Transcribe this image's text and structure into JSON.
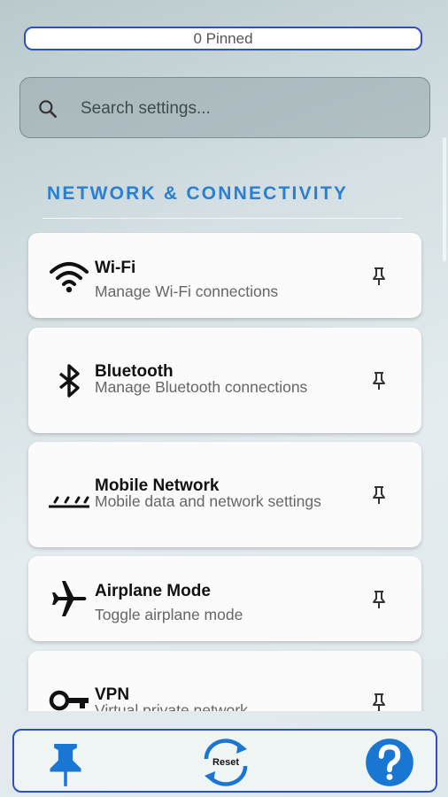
{
  "pinned_count_label": "0 Pinned",
  "search": {
    "placeholder": "Search settings..."
  },
  "section": {
    "title": "NETWORK & CONNECTIVITY"
  },
  "items": [
    {
      "title": "Wi-Fi",
      "description": "Manage Wi-Fi connections",
      "icon": "wifi-icon"
    },
    {
      "title": "Bluetooth",
      "description": "Manage Bluetooth connections",
      "icon": "bluetooth-icon"
    },
    {
      "title": "Mobile Network",
      "description": "Mobile data and network settings",
      "icon": "mobile-network-icon"
    },
    {
      "title": "Airplane Mode",
      "description": "Toggle airplane mode",
      "icon": "airplane-icon"
    },
    {
      "title": "VPN",
      "description": "Virtual private network",
      "icon": "key-icon"
    }
  ],
  "bottom_bar": {
    "reset_label": "Reset"
  },
  "colors": {
    "accent": "#2a7fd3",
    "border": "#2d4fc2",
    "icon_blue": "#1976d2"
  }
}
